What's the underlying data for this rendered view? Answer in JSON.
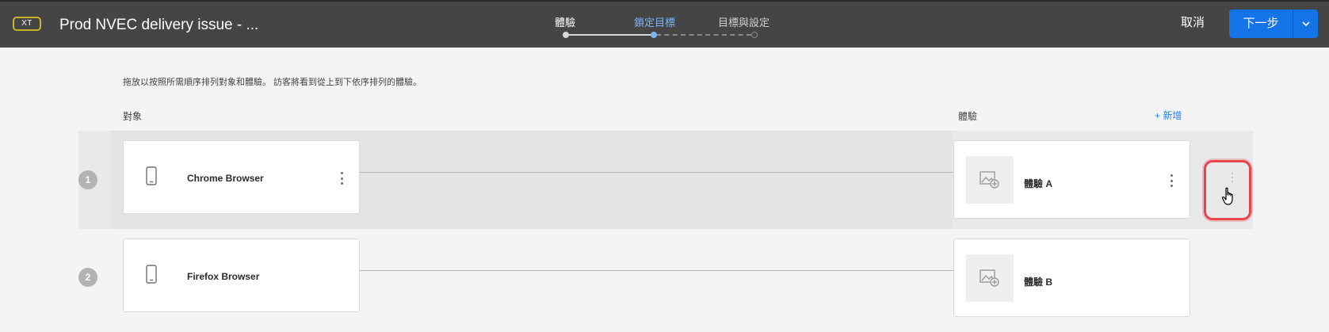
{
  "header": {
    "badge": "XT",
    "title": "Prod NVEC delivery issue - ...",
    "steps": [
      {
        "label": "體驗",
        "state": "done"
      },
      {
        "label": "鎖定目標",
        "state": "active"
      },
      {
        "label": "目標與設定",
        "state": "future"
      }
    ],
    "cancel_label": "取消",
    "next_label": "下一步"
  },
  "instruction": "拖放以按照所需順序排列對象和體驗。 訪客將看到從上到下依序排列的體驗。",
  "columns": {
    "audience_label": "對象",
    "experience_label": "體驗",
    "add_label": "+ 新增"
  },
  "rows": [
    {
      "number": "1",
      "audience": "Chrome Browser",
      "experience": "體驗 A"
    },
    {
      "number": "2",
      "audience": "Firefox Browser",
      "experience": "體驗 B"
    }
  ],
  "colors": {
    "header_bg": "#454545",
    "accent": "#1473e6",
    "active_step": "#7db4ee",
    "highlight": "#e5444c"
  },
  "icons": [
    "mobile-device-icon",
    "image-add-icon",
    "more-vertical-icon",
    "chevron-down-icon",
    "drag-handle-icon",
    "hand-pointer-cursor"
  ]
}
